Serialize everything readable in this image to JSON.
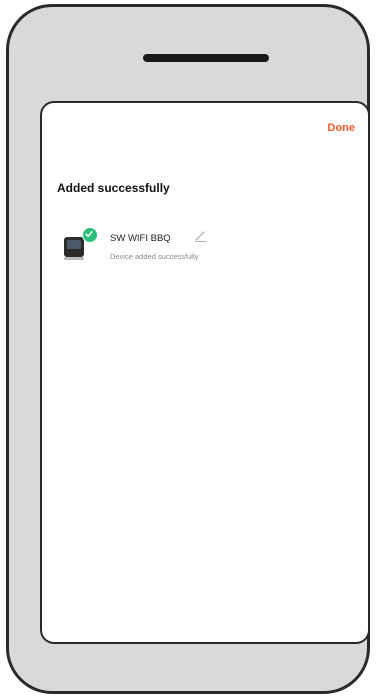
{
  "header": {
    "done_label": "Done"
  },
  "main": {
    "title": "Added successfully",
    "device": {
      "name": "SW WIFI BBQ",
      "status": "Device added successfully",
      "icon": "grill-device-icon",
      "badge_icon": "check-icon",
      "edit_icon": "edit-pencil-icon"
    }
  },
  "colors": {
    "accent": "#ee5a28",
    "success": "#2cc07a",
    "phone_frame": "#d9d9d9"
  }
}
